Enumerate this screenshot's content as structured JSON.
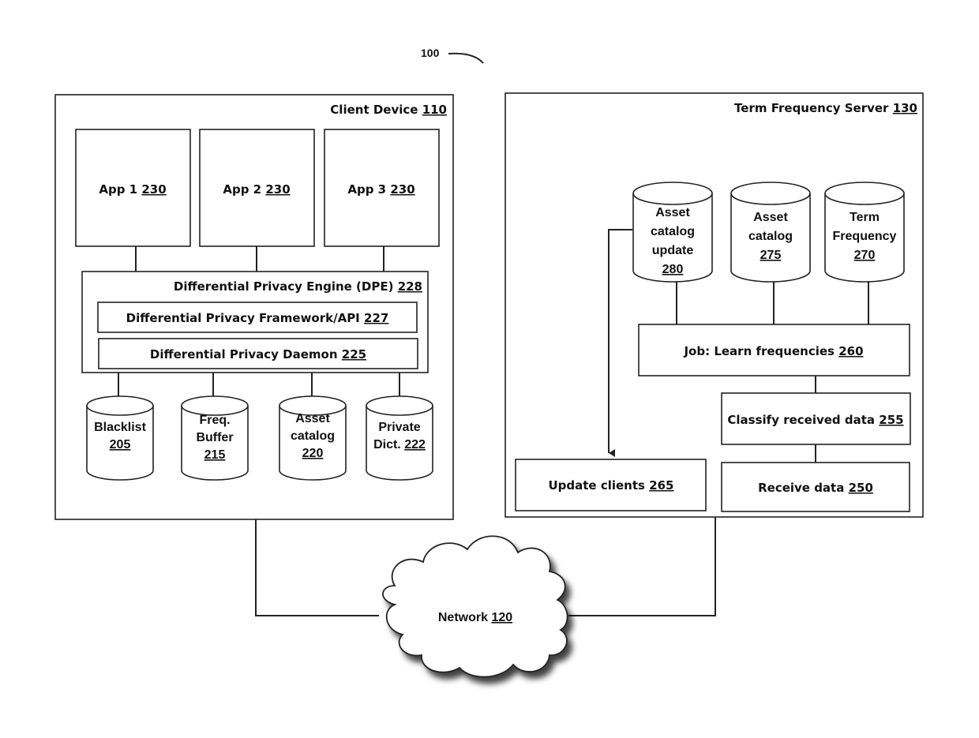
{
  "figure": {
    "number": "100"
  },
  "client_device": {
    "title": "Client Device",
    "ref": "110",
    "apps": [
      {
        "label": "App 1",
        "ref": "230"
      },
      {
        "label": "App 2",
        "ref": "230"
      },
      {
        "label": "App 3",
        "ref": "230"
      }
    ],
    "dpe": {
      "label": "Differential Privacy Engine (DPE)",
      "ref": "228"
    },
    "framework": {
      "label": "Differential Privacy Framework/API",
      "ref": "227"
    },
    "daemon": {
      "label": "Differential Privacy Daemon",
      "ref": "225"
    },
    "stores": [
      {
        "lines": [
          "Blacklist"
        ],
        "ref": "205"
      },
      {
        "lines": [
          "Freq.",
          "Buffer"
        ],
        "ref": "215"
      },
      {
        "lines": [
          "Asset",
          "catalog"
        ],
        "ref": "220"
      },
      {
        "lines": [
          "Private",
          "Dict."
        ],
        "ref": "222"
      }
    ]
  },
  "server": {
    "title": "Term Frequency Server",
    "ref": "130",
    "stores": [
      {
        "lines": [
          "Asset",
          "catalog",
          "update"
        ],
        "ref": "280"
      },
      {
        "lines": [
          "Asset",
          "catalog"
        ],
        "ref": "275"
      },
      {
        "lines": [
          "Term",
          "Frequency"
        ],
        "ref": "270"
      }
    ],
    "job": {
      "label": "Job: Learn frequencies",
      "ref": "260"
    },
    "classify": {
      "label": "Classify received data",
      "ref": "255"
    },
    "receive": {
      "label": "Receive data",
      "ref": "250"
    },
    "update": {
      "label": "Update clients",
      "ref": "265"
    }
  },
  "network": {
    "label": "Network",
    "ref": "120"
  }
}
